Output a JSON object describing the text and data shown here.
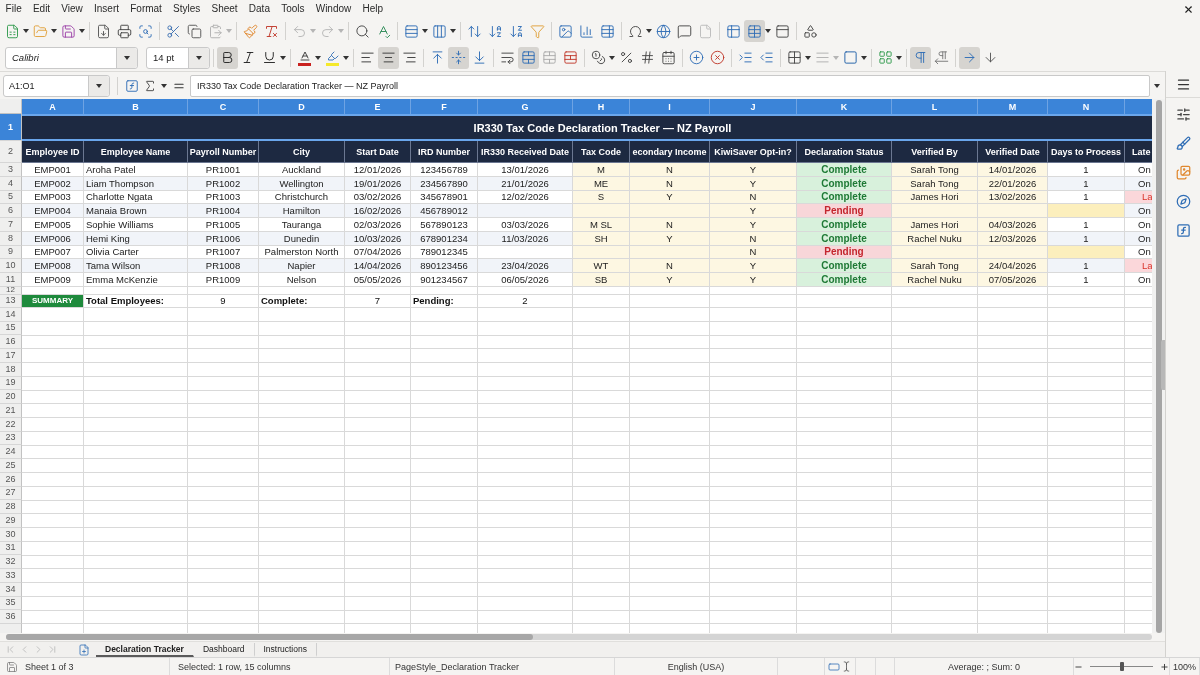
{
  "menu_bar": {
    "items": [
      "File",
      "Edit",
      "View",
      "Insert",
      "Format",
      "Styles",
      "Sheet",
      "Data",
      "Tools",
      "Window",
      "Help"
    ]
  },
  "standard_toolbar": {
    "freeze_rows_columns": true
  },
  "formatting_toolbar": {
    "font_name": "Calibri",
    "font_size": "14 pt",
    "bold": true,
    "italic": false,
    "underline": false,
    "align_left": false,
    "align_center": true,
    "align_right": false,
    "align_top": false,
    "align_middle": true,
    "align_bottom": false,
    "wrap_text": false,
    "merge_and_center": true,
    "left_to_right": true,
    "right_to_left": false,
    "text_left_to_right": true,
    "text_top_to_bottom": false
  },
  "formula_bar": {
    "cell_reference": "A1:O1",
    "content": "IR330 Tax Code Declaration Tracker — NZ Payroll"
  },
  "sheet": {
    "columns": [
      {
        "letter": "A",
        "heading": "Employee ID",
        "selected": true
      },
      {
        "letter": "B",
        "heading": "Employee Name",
        "selected": true
      },
      {
        "letter": "C",
        "heading": "Payroll Number",
        "selected": true
      },
      {
        "letter": "D",
        "heading": "City",
        "selected": true
      },
      {
        "letter": "E",
        "heading": "Start Date",
        "selected": true
      },
      {
        "letter": "F",
        "heading": "IRD Number",
        "selected": true
      },
      {
        "letter": "G",
        "heading": "IR330 Received Date",
        "selected": true
      },
      {
        "letter": "H",
        "heading": "Tax Code",
        "selected": true
      },
      {
        "letter": "I",
        "heading": "econdary Income",
        "selected": true
      },
      {
        "letter": "J",
        "heading": "KiwiSaver Opt-in?",
        "selected": true
      },
      {
        "letter": "K",
        "heading": "Declaration Status",
        "selected": true
      },
      {
        "letter": "L",
        "heading": "Verified By",
        "selected": true
      },
      {
        "letter": "M",
        "heading": "Verified Date",
        "selected": true
      },
      {
        "letter": "N",
        "heading": "Days to Process",
        "selected": true
      },
      {
        "heading": "Late",
        "selected": true
      }
    ],
    "row_numbers": [
      {
        "label": "1",
        "selected": true
      },
      {
        "label": "2",
        "selected": false
      },
      {
        "label": "3",
        "selected": false
      },
      {
        "label": "4",
        "selected": false
      },
      {
        "label": "5",
        "selected": false
      },
      {
        "label": "6",
        "selected": false
      },
      {
        "label": "7",
        "selected": false
      },
      {
        "label": "8",
        "selected": false
      },
      {
        "label": "9",
        "selected": false
      },
      {
        "label": "10",
        "selected": false
      },
      {
        "label": "11",
        "selected": false
      },
      {
        "label": "12",
        "selected": false
      },
      {
        "label": "13",
        "selected": false
      },
      {
        "label": "14",
        "selected": false
      },
      {
        "label": "15",
        "selected": false
      },
      {
        "label": "16",
        "selected": false
      },
      {
        "label": "17",
        "selected": false
      },
      {
        "label": "18",
        "selected": false
      },
      {
        "label": "19",
        "selected": false
      },
      {
        "label": "20",
        "selected": false
      },
      {
        "label": "21",
        "selected": false
      },
      {
        "label": "22",
        "selected": false
      },
      {
        "label": "23",
        "selected": false
      },
      {
        "label": "24",
        "selected": false
      },
      {
        "label": "25",
        "selected": false
      },
      {
        "label": "26",
        "selected": false
      },
      {
        "label": "27",
        "selected": false
      },
      {
        "label": "28",
        "selected": false
      },
      {
        "label": "29",
        "selected": false
      },
      {
        "label": "30",
        "selected": false
      },
      {
        "label": "31",
        "selected": false
      },
      {
        "label": "32",
        "selected": false
      },
      {
        "label": "33",
        "selected": false
      },
      {
        "label": "34",
        "selected": false
      },
      {
        "label": "35",
        "selected": false
      },
      {
        "label": "36",
        "selected": false
      }
    ],
    "title": "IR330 Tax Code Declaration Tracker — NZ Payroll",
    "rows": [
      {
        "cells": [
          "EMP001",
          "Aroha Patel",
          "PR1001",
          "Auckland",
          "12/01/2026",
          "123456789",
          "13/01/2026",
          "M",
          "N",
          "Y",
          "Complete",
          "Sarah Tong",
          "14/01/2026",
          "1",
          "On"
        ],
        "pending": false,
        "late": false
      },
      {
        "cells": [
          "EMP002",
          "Liam Thompson",
          "PR1002",
          "Wellington",
          "19/01/2026",
          "234567890",
          "21/01/2026",
          "ME",
          "N",
          "Y",
          "Complete",
          "Sarah Tong",
          "22/01/2026",
          "1",
          "On"
        ],
        "pending": false,
        "late": false
      },
      {
        "cells": [
          "EMP003",
          "Charlotte Ngata",
          "PR1003",
          "Christchurch",
          "03/02/2026",
          "345678901",
          "12/02/2026",
          "S",
          "Y",
          "N",
          "Complete",
          "James Hori",
          "13/02/2026",
          "1",
          "La"
        ],
        "pending": false,
        "late": true
      },
      {
        "cells": [
          "EMP004",
          "Manaia Brown",
          "PR1004",
          "Hamilton",
          "16/02/2026",
          "456789012",
          null,
          null,
          null,
          "Y",
          "Pending",
          null,
          null,
          null,
          "On"
        ],
        "pending": true,
        "late": false
      },
      {
        "cells": [
          "EMP005",
          "Sophie Williams",
          "PR1005",
          "Tauranga",
          "02/03/2026",
          "567890123",
          "03/03/2026",
          "M SL",
          "N",
          "Y",
          "Complete",
          "James Hori",
          "04/03/2026",
          "1",
          "On"
        ],
        "pending": false,
        "late": false
      },
      {
        "cells": [
          "EMP006",
          "Hemi King",
          "PR1006",
          "Dunedin",
          "10/03/2026",
          "678901234",
          "11/03/2026",
          "SH",
          "Y",
          "N",
          "Complete",
          "Rachel Nuku",
          "12/03/2026",
          "1",
          "On"
        ],
        "pending": false,
        "late": false
      },
      {
        "cells": [
          "EMP007",
          "Olivia Carter",
          "PR1007",
          "Palmerston North",
          "07/04/2026",
          "789012345",
          null,
          null,
          null,
          "N",
          "Pending",
          null,
          null,
          null,
          "On"
        ],
        "pending": true,
        "late": false
      },
      {
        "cells": [
          "EMP008",
          "Tama Wilson",
          "PR1008",
          "Napier",
          "14/04/2026",
          "890123456",
          "23/04/2026",
          "WT",
          "N",
          "Y",
          "Complete",
          "Sarah Tong",
          "24/04/2026",
          "1",
          "La"
        ],
        "pending": false,
        "late": true
      },
      {
        "cells": [
          "EMP009",
          "Emma McKenzie",
          "PR1009",
          "Nelson",
          "05/05/2026",
          "901234567",
          "06/05/2026",
          "SB",
          "Y",
          "Y",
          "Complete",
          "Rachel Nuku",
          "07/05/2026",
          "1",
          "On"
        ],
        "pending": false,
        "late": false
      }
    ],
    "summary": {
      "label": "SUMMARY",
      "items": [
        {
          "label": "Total Employees:",
          "value": "9"
        },
        {
          "label": "Complete:",
          "value": "7"
        },
        {
          "label": "Pending:",
          "value": "2"
        }
      ]
    }
  },
  "sheet_tabs": [
    {
      "label": "Declaration Tracker",
      "selected": true
    },
    {
      "label": "Dashboard",
      "selected": false
    },
    {
      "label": "Instructions",
      "selected": false
    }
  ],
  "status_bar": {
    "sheet": "Sheet 1 of 3",
    "selection": "Selected: 1 row, 15 columns",
    "page_style": "PageStyle_Declaration Tracker",
    "language": "English (USA)",
    "statistics": "Average: ; Sum: 0",
    "zoom": {
      "level": 0.5,
      "reading": "100%"
    }
  }
}
